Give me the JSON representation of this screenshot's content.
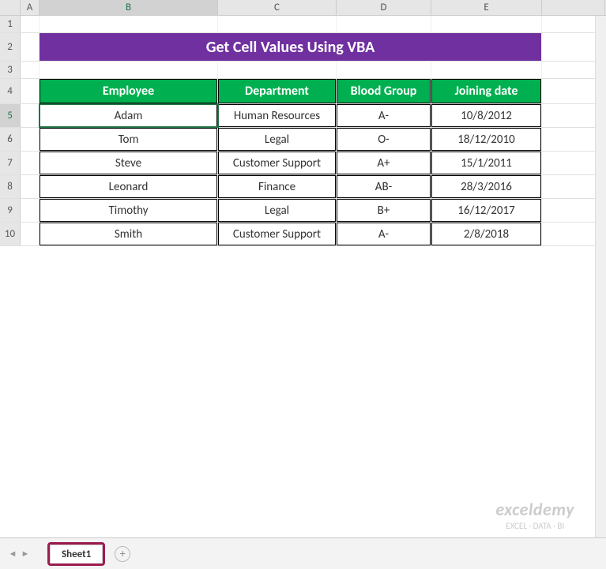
{
  "columns": [
    "A",
    "B",
    "C",
    "D",
    "E"
  ],
  "active_cell": "B5",
  "title": "Get Cell Values Using VBA",
  "headers": {
    "employee": "Employee",
    "department": "Department",
    "blood": "Blood Group",
    "joining": "Joining date"
  },
  "rows": [
    {
      "employee": "Adam",
      "department": "Human Resources",
      "blood": "A-",
      "joining": "10/8/2012"
    },
    {
      "employee": "Tom",
      "department": "Legal",
      "blood": "O-",
      "joining": "18/12/2010"
    },
    {
      "employee": "Steve",
      "department": "Customer Support",
      "blood": "A+",
      "joining": "15/1/2011"
    },
    {
      "employee": "Leonard",
      "department": "Finance",
      "blood": "AB-",
      "joining": "28/3/2016"
    },
    {
      "employee": "Timothy",
      "department": "Legal",
      "blood": "B+",
      "joining": "16/12/2017"
    },
    {
      "employee": "Smith",
      "department": "Customer Support",
      "blood": "A-",
      "joining": "2/8/2018"
    }
  ],
  "sheet_tab": "Sheet1",
  "watermark": {
    "big": "exceldemy",
    "small": "EXCEL · DATA · BI"
  }
}
